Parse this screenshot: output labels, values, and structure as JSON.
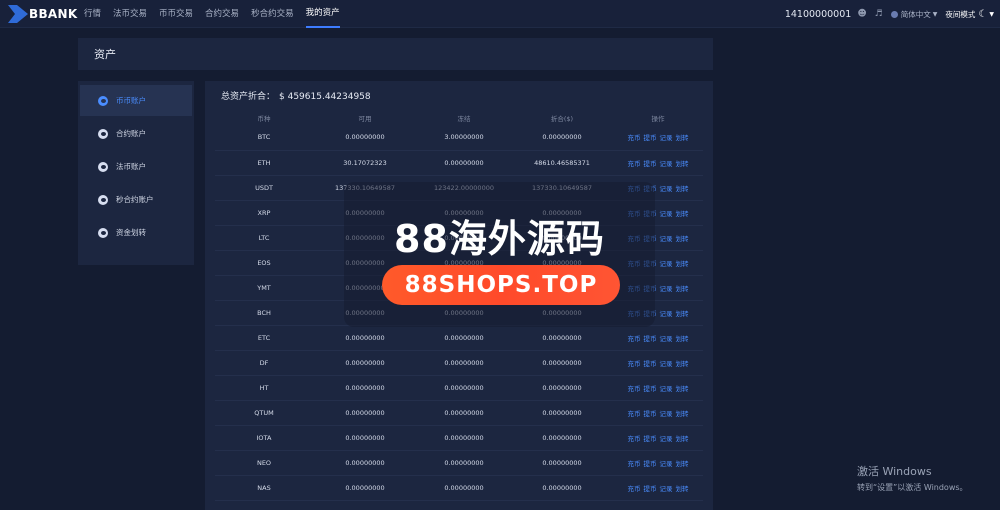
{
  "brand": {
    "name": "BBANK"
  },
  "nav": {
    "items": [
      "行情",
      "法币交易",
      "币币交易",
      "合约交易",
      "秒合约交易",
      "我的资产"
    ],
    "active_index": 5
  },
  "header_right": {
    "user_id": "14100000001",
    "language": "简体中文",
    "night_mode": "夜间模式"
  },
  "page": {
    "title": "资产"
  },
  "sidebar": {
    "items": [
      {
        "label": "币币账户",
        "active": true
      },
      {
        "label": "合约账户",
        "active": false
      },
      {
        "label": "法币账户",
        "active": false
      },
      {
        "label": "秒合约账户",
        "active": false
      },
      {
        "label": "资金划转",
        "active": false
      }
    ]
  },
  "summary": {
    "label": "总资产折合：",
    "amount": "$ 459615.44234958"
  },
  "table": {
    "headers": [
      "币种",
      "可用",
      "冻结",
      "折合($)",
      "操作"
    ],
    "actions": [
      "充币",
      "提币",
      "记录",
      "划转"
    ],
    "rows": [
      [
        "BTC",
        "0.00000000",
        "3.00000000",
        "0.00000000"
      ],
      [
        "ETH",
        "30.17072323",
        "0.00000000",
        "48610.46585371"
      ],
      [
        "USDT",
        "137330.10649587",
        "123422.00000000",
        "137330.10649587"
      ],
      [
        "XRP",
        "0.00000000",
        "0.00000000",
        "0.00000000"
      ],
      [
        "LTC",
        "0.00000000",
        "0.00000000",
        "0.00000000"
      ],
      [
        "EOS",
        "0.00000000",
        "0.00000000",
        "0.00000000"
      ],
      [
        "YMT",
        "0.00000000",
        "0.00000000",
        "0.00000000"
      ],
      [
        "BCH",
        "0.00000000",
        "0.00000000",
        "0.00000000"
      ],
      [
        "ETC",
        "0.00000000",
        "0.00000000",
        "0.00000000"
      ],
      [
        "DF",
        "0.00000000",
        "0.00000000",
        "0.00000000"
      ],
      [
        "HT",
        "0.00000000",
        "0.00000000",
        "0.00000000"
      ],
      [
        "QTUM",
        "0.00000000",
        "0.00000000",
        "0.00000000"
      ],
      [
        "IOTA",
        "0.00000000",
        "0.00000000",
        "0.00000000"
      ],
      [
        "NEO",
        "0.00000000",
        "0.00000000",
        "0.00000000"
      ],
      [
        "NAS",
        "0.00000000",
        "0.00000000",
        "0.00000000"
      ]
    ]
  },
  "watermark": {
    "title": "88海外源码",
    "url": "88SHOPS.TOP"
  },
  "windows_activation": {
    "title": "激活 Windows",
    "subtitle": "转到“设置”以激活 Windows。"
  },
  "colors": {
    "background": "#141c31",
    "panel": "#1c2640",
    "accent": "#4a8dff",
    "watermark_pill": "#ff4a2a"
  },
  "icons": {
    "user": "user-icon",
    "speaker": "speaker-icon",
    "globe": "globe-icon",
    "moon": "moon-icon",
    "chevron": "chevron-down-icon"
  }
}
